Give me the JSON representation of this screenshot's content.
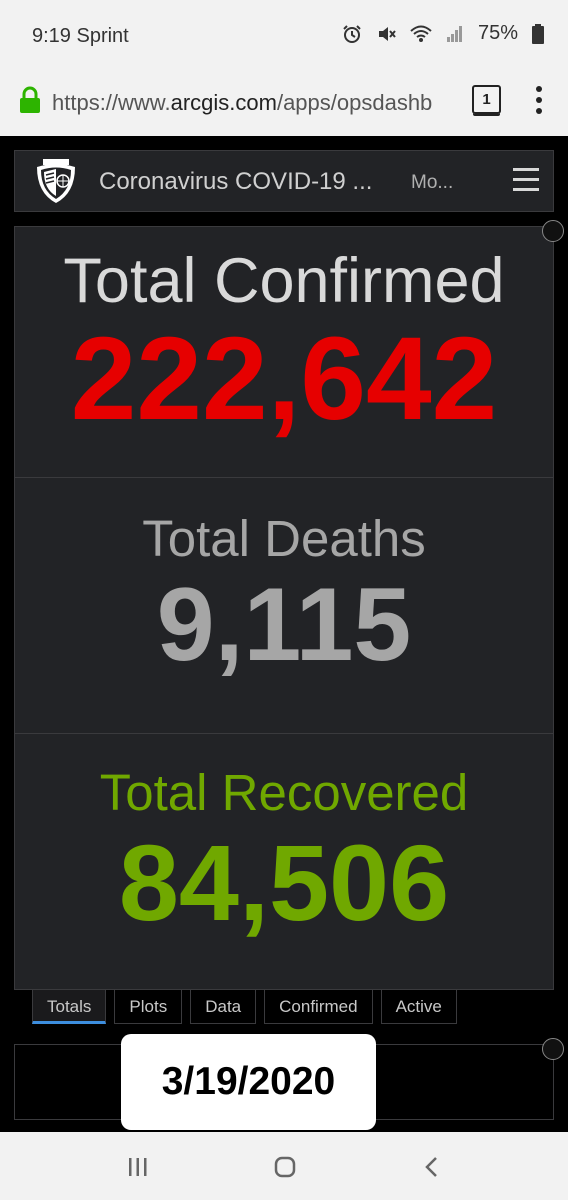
{
  "status_bar": {
    "time_carrier": "9:19 Sprint",
    "battery_percent": "75%"
  },
  "browser": {
    "url_prefix": "https://www.",
    "url_domain": "arcgis.com",
    "url_path": "/apps/opsdashb",
    "tab_count": "1"
  },
  "dashboard": {
    "title": "Coronavirus COVID-19 ...",
    "subtitle": "Mo...",
    "confirmed": {
      "label": "Total Confirmed",
      "value": "222,642",
      "color": "#e60000"
    },
    "deaths": {
      "label": "Total Deaths",
      "value": "9,115",
      "color": "#a6a6a6"
    },
    "recovered": {
      "label": "Total Recovered",
      "value": "84,506",
      "color": "#70a800"
    },
    "tabs": [
      "Totals",
      "Plots",
      "Data",
      "Confirmed",
      "Active"
    ],
    "active_tab": "Totals"
  },
  "overlay": {
    "date": "3/19/2020"
  }
}
